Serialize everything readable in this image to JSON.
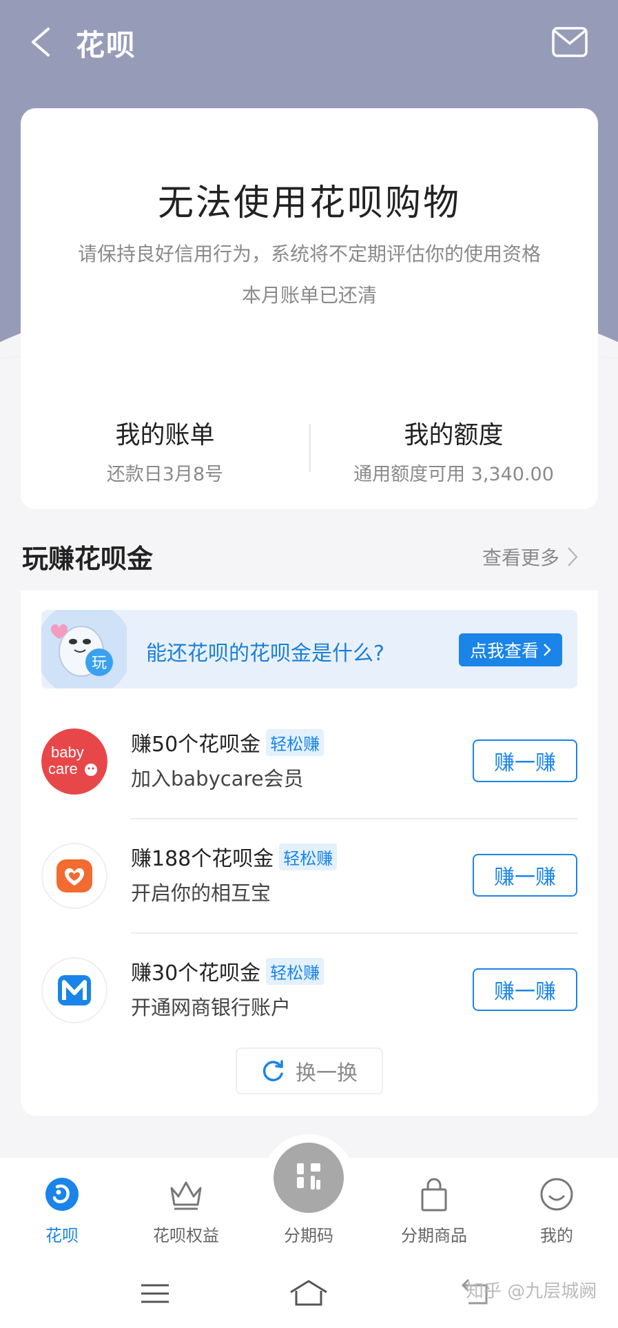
{
  "header": {
    "title": "花呗"
  },
  "status": {
    "title": "无法使用花呗购物",
    "description": "请保持良好信用行为，系统将不定期评估你的使用资格",
    "bill_status": "本月账单已还清",
    "my_bill": {
      "label": "我的账单",
      "detail": "还款日3月8号"
    },
    "my_limit": {
      "label": "我的额度",
      "detail": "通用额度可用 3,340.00"
    }
  },
  "earn_section": {
    "title": "玩赚花呗金",
    "see_more": "查看更多",
    "banner": {
      "text": "能还花呗的花呗金是什么?",
      "button": "点我查看",
      "mascot_badge": "玩"
    },
    "tasks": [
      {
        "title": "赚50个花呗金",
        "tag": "轻松赚",
        "desc": "加入babycare会员",
        "button": "赚一赚",
        "logo": "babycare-logo",
        "logo_text_1": "baby",
        "logo_text_2": "care"
      },
      {
        "title": "赚188个花呗金",
        "tag": "轻松赚",
        "desc": "开启你的相互宝",
        "button": "赚一赚",
        "logo": "xianghubao-logo"
      },
      {
        "title": "赚30个花呗金",
        "tag": "轻松赚",
        "desc": "开通网商银行账户",
        "button": "赚一赚",
        "logo": "mybank-logo"
      }
    ],
    "refresh": "换一换"
  },
  "bottom_nav": {
    "items": [
      {
        "label": "花呗",
        "icon": "huabei-icon",
        "active": true
      },
      {
        "label": "花呗权益",
        "icon": "crown-icon"
      },
      {
        "label": "分期码",
        "icon": "qr-code-icon"
      },
      {
        "label": "分期商品",
        "icon": "shopping-bag-icon"
      },
      {
        "label": "我的",
        "icon": "smiley-icon"
      }
    ]
  },
  "watermark": "知乎 @九层城阙",
  "colors": {
    "accent": "#1a84e8",
    "header_bg": "#969cb8",
    "babycare_red": "#e8474a",
    "xianghubao_orange": "#f26b30",
    "mybank_blue": "#1a84e8"
  }
}
